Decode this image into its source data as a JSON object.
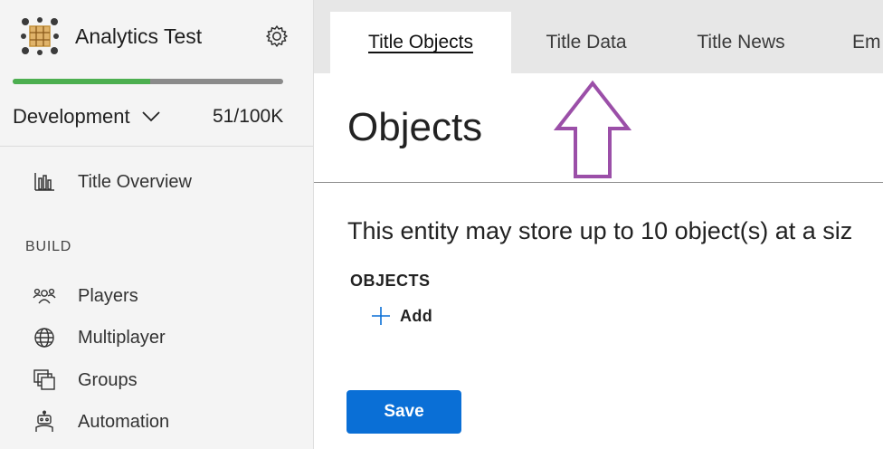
{
  "sidebar": {
    "app_title": "Analytics Test",
    "usage_fraction": 0.51,
    "environment": "Development",
    "usage_count": "51/100K",
    "overview_label": "Title Overview",
    "section_build": "BUILD",
    "items": [
      {
        "label": "Players",
        "icon": "players-icon"
      },
      {
        "label": "Multiplayer",
        "icon": "globe-icon"
      },
      {
        "label": "Groups",
        "icon": "groups-icon"
      },
      {
        "label": "Automation",
        "icon": "robot-icon"
      }
    ]
  },
  "tabs": [
    {
      "label": "Title Objects",
      "active": true
    },
    {
      "label": "Title Data",
      "active": false
    },
    {
      "label": "Title News",
      "active": false
    },
    {
      "label": "Em",
      "active": false
    }
  ],
  "main": {
    "title": "Objects",
    "description": "This entity may store up to 10 object(s) at a siz",
    "objects_heading": "OBJECTS",
    "add_label": "Add",
    "save_label": "Save"
  },
  "colors": {
    "accent": "#0a6fd6",
    "progress": "#4caf50",
    "annotation_arrow": "#9b4fa8"
  }
}
